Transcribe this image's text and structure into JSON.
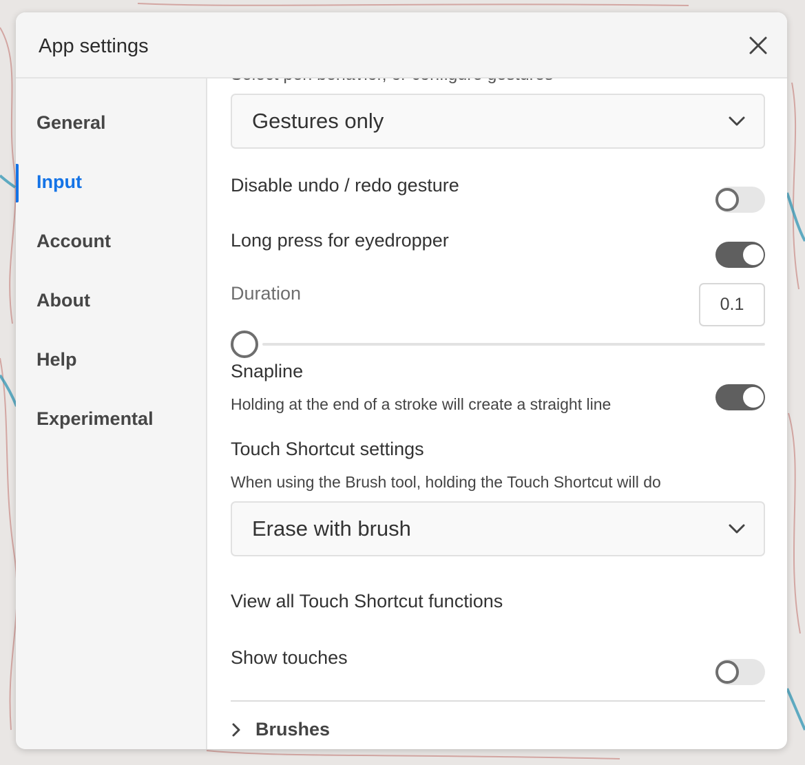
{
  "dialog": {
    "title": "App settings"
  },
  "sidebar": {
    "items": [
      {
        "label": "General"
      },
      {
        "label": "Input"
      },
      {
        "label": "Account"
      },
      {
        "label": "About"
      },
      {
        "label": "Help"
      },
      {
        "label": "Experimental"
      }
    ],
    "active": "Input"
  },
  "content": {
    "cut_off_text": "Select pen behavior, or configure gestures",
    "input_mode_select": {
      "value": "Gestures only"
    },
    "disable_undo": {
      "label": "Disable undo / redo gesture",
      "on": false
    },
    "long_press": {
      "label": "Long press for eyedropper",
      "on": true
    },
    "duration": {
      "label": "Duration",
      "value": "0.1"
    },
    "snapline": {
      "label": "Snapline",
      "description": "Holding at the end of a stroke will create a straight line",
      "on": true
    },
    "touch_shortcut": {
      "heading": "Touch Shortcut settings",
      "description": "When using the Brush tool, holding the Touch Shortcut will do",
      "select_value": "Erase with brush",
      "view_all_link": "View all Touch Shortcut functions"
    },
    "show_touches": {
      "label": "Show touches",
      "on": false
    },
    "brushes_section": {
      "label": "Brushes"
    }
  },
  "colors": {
    "accent": "#1473e6",
    "toggle_on": "#5f5f5f",
    "toggle_off": "#e6e6e6"
  }
}
